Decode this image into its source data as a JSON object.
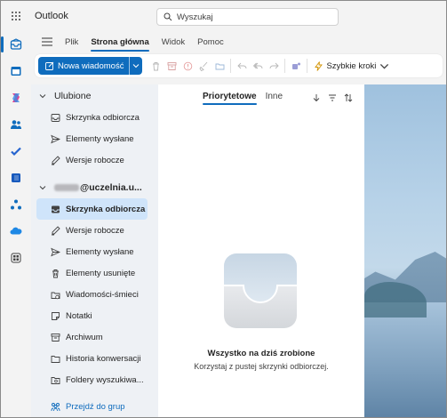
{
  "app": {
    "title": "Outlook"
  },
  "search": {
    "placeholder": "Wyszukaj"
  },
  "ribbon": {
    "tabs": [
      {
        "label": "Plik",
        "active": false
      },
      {
        "label": "Strona główna",
        "active": true
      },
      {
        "label": "Widok",
        "active": false
      },
      {
        "label": "Pomoc",
        "active": false
      }
    ],
    "new_mail_label": "Nowa wiadomość",
    "quick_steps_label": "Szybkie kroki"
  },
  "rail": {
    "items": [
      "mail-icon",
      "calendar-icon",
      "copilot-icon",
      "people-icon",
      "todo-icon",
      "word-icon",
      "org-icon",
      "onedrive-icon",
      "apps-icon"
    ]
  },
  "favorites": {
    "header": "Ulubione",
    "items": [
      {
        "label": "Skrzynka odbiorcza",
        "icon": "inbox-icon"
      },
      {
        "label": "Elementy wysłane",
        "icon": "send-icon"
      },
      {
        "label": "Wersje robocze",
        "icon": "draft-icon"
      }
    ]
  },
  "account": {
    "name_suffix": "@uczelnia.u...",
    "items": [
      {
        "label": "Skrzynka odbiorcza",
        "icon": "inbox-icon",
        "active": true
      },
      {
        "label": "Wersje robocze",
        "icon": "draft-icon"
      },
      {
        "label": "Elementy wysłane",
        "icon": "send-icon"
      },
      {
        "label": "Elementy usunięte",
        "icon": "trash-icon"
      },
      {
        "label": "Wiadomości-śmieci",
        "icon": "junk-icon"
      },
      {
        "label": "Notatki",
        "icon": "note-icon"
      },
      {
        "label": "Archiwum",
        "icon": "archive-icon"
      },
      {
        "label": "Historia konwersacji",
        "icon": "folder-icon"
      },
      {
        "label": "Foldery wyszukiwa...",
        "icon": "search-folder-icon"
      }
    ],
    "groups_link": "Przejdź do grup"
  },
  "message_list": {
    "tabs": [
      {
        "label": "Priorytetowe",
        "active": true
      },
      {
        "label": "Inne",
        "active": false
      }
    ],
    "empty_title": "Wszystko na dziś zrobione",
    "empty_subtitle": "Korzystaj z pustej skrzynki odbiorczej."
  },
  "colors": {
    "accent": "#0f6cbd",
    "selected": "#cfe4fa"
  }
}
